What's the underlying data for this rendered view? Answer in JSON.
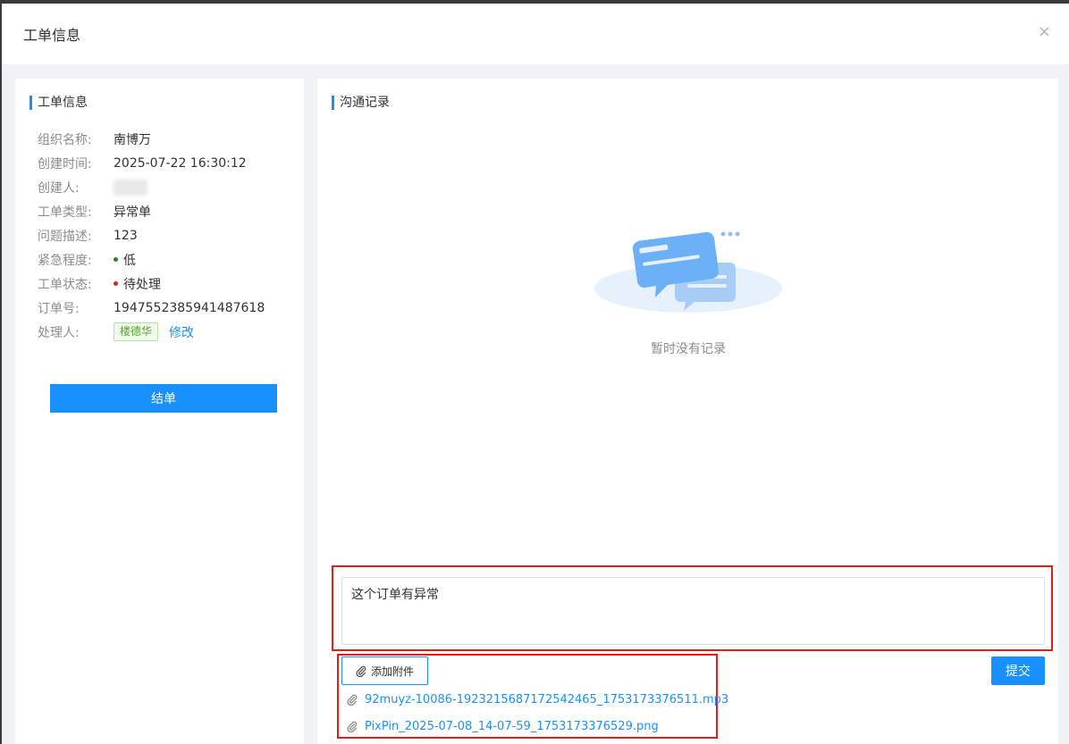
{
  "dialog": {
    "title": "工单信息",
    "close_symbol": "×"
  },
  "left": {
    "section_title": "工单信息",
    "fields": {
      "org": {
        "label": "组织名称:",
        "value": "南博万"
      },
      "created": {
        "label": "创建时间:",
        "value": "2025-07-22 16:30:12"
      },
      "creator": {
        "label": "创建人:"
      },
      "type": {
        "label": "工单类型:",
        "value": "异常单"
      },
      "desc": {
        "label": "问题描述:",
        "value": "123"
      },
      "urgency": {
        "label": "紧急程度:",
        "value": "低",
        "color": "#1a8a1a"
      },
      "status": {
        "label": "工单状态:",
        "value": "待处理",
        "color": "#e81a1a"
      },
      "order": {
        "label": "订单号:",
        "value": "1947552385941487618"
      },
      "handler": {
        "label": "处理人:",
        "value": "楼德华",
        "edit_label": "修改"
      }
    },
    "close_button": "结单"
  },
  "right": {
    "section_title": "沟通记录",
    "empty_text": "暂时没有记录",
    "message_value": "这个订单有异常",
    "attach_button": "添加附件",
    "submit_button": "提交",
    "attachments": [
      "92muyz-10086-1923215687172542465_1753173376511.mp3",
      "PixPin_2025-07-08_14-07-59_1753173376529.png"
    ]
  },
  "colors": {
    "accent": "#1890ff",
    "annotation": "#e81a1a"
  }
}
